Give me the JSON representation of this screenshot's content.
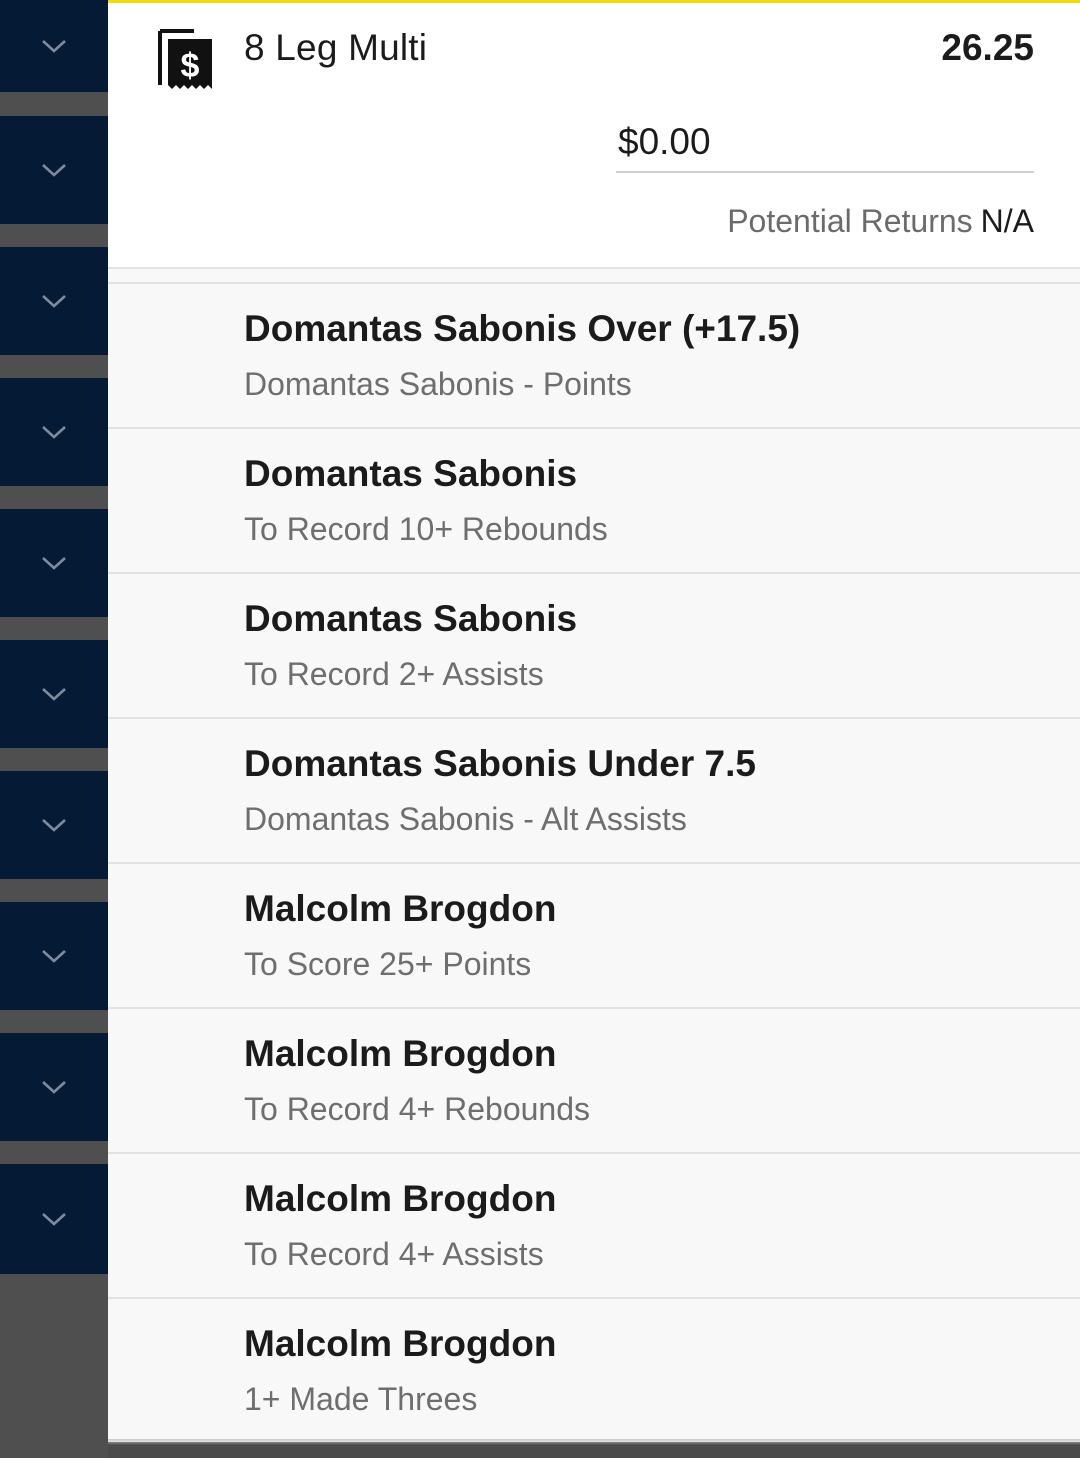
{
  "rail": {
    "items": [
      {
        "icon": "chevron-down-icon"
      },
      {
        "icon": "chevron-down-icon"
      },
      {
        "icon": "chevron-down-icon"
      },
      {
        "icon": "chevron-down-icon"
      },
      {
        "icon": "chevron-down-icon"
      },
      {
        "icon": "chevron-down-icon"
      },
      {
        "icon": "chevron-down-icon"
      },
      {
        "icon": "chevron-down-icon"
      },
      {
        "icon": "chevron-down-icon"
      },
      {
        "icon": "chevron-down-icon"
      }
    ],
    "color": "#051a35",
    "chevron_color": "#7f8b9c"
  },
  "bet": {
    "icon": "receipt-dollar-icon",
    "title": "8 Leg Multi",
    "odds": "26.25",
    "stake": "$0.00",
    "returns_label": "Potential Returns",
    "returns_value": "N/A",
    "accent_color": "#f5d90a"
  },
  "legs": [
    {
      "selection": "Domantas Sabonis Over (+17.5)",
      "market": "Domantas Sabonis - Points"
    },
    {
      "selection": "Domantas Sabonis",
      "market": "To Record 10+ Rebounds"
    },
    {
      "selection": "Domantas Sabonis",
      "market": "To Record 2+ Assists"
    },
    {
      "selection": "Domantas Sabonis Under 7.5",
      "market": "Domantas Sabonis - Alt Assists"
    },
    {
      "selection": "Malcolm Brogdon",
      "market": "To Score 25+ Points"
    },
    {
      "selection": "Malcolm Brogdon",
      "market": "To Record 4+ Rebounds"
    },
    {
      "selection": "Malcolm Brogdon",
      "market": "To Record 4+ Assists"
    },
    {
      "selection": "Malcolm Brogdon",
      "market": "1+ Made Threes"
    }
  ]
}
